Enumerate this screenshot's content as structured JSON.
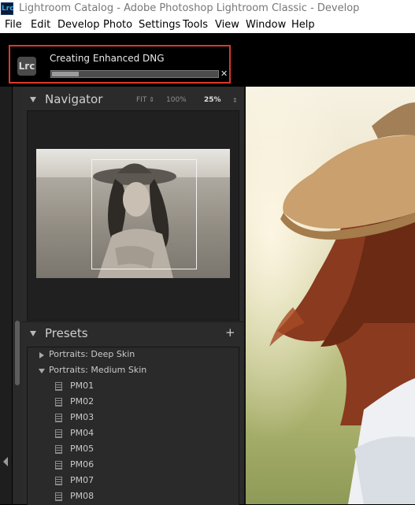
{
  "window": {
    "title": "Lightroom Catalog - Adobe Photoshop Lightroom Classic - Develop",
    "app_icon_text": "Lrc"
  },
  "menu": [
    "File",
    "Edit",
    "Develop",
    "Photo",
    "Settings",
    "Tools",
    "View",
    "Window",
    "Help"
  ],
  "task": {
    "logo": "Lrc",
    "label": "Creating Enhanced DNG",
    "progress": 0.16,
    "close_icon": "close-icon"
  },
  "navigator": {
    "title": "Navigator",
    "zoom_options": [
      {
        "label": "FIT",
        "active": false
      },
      {
        "label": "100%",
        "active": false
      },
      {
        "label": "25%",
        "active": true
      }
    ],
    "spinner_glyph": "⇕"
  },
  "presets": {
    "title": "Presets",
    "add_glyph": "+",
    "folders": [
      {
        "label": "Portraits: Deep Skin",
        "expanded": false
      },
      {
        "label": "Portraits: Medium Skin",
        "expanded": true
      }
    ],
    "items": [
      "PM01",
      "PM02",
      "PM03",
      "PM04",
      "PM05",
      "PM06",
      "PM07",
      "PM08"
    ]
  },
  "colors": {
    "accent_red": "#d9392c",
    "panel_bg": "#2b2b2b",
    "app_icon_blue": "#31a8ff"
  }
}
